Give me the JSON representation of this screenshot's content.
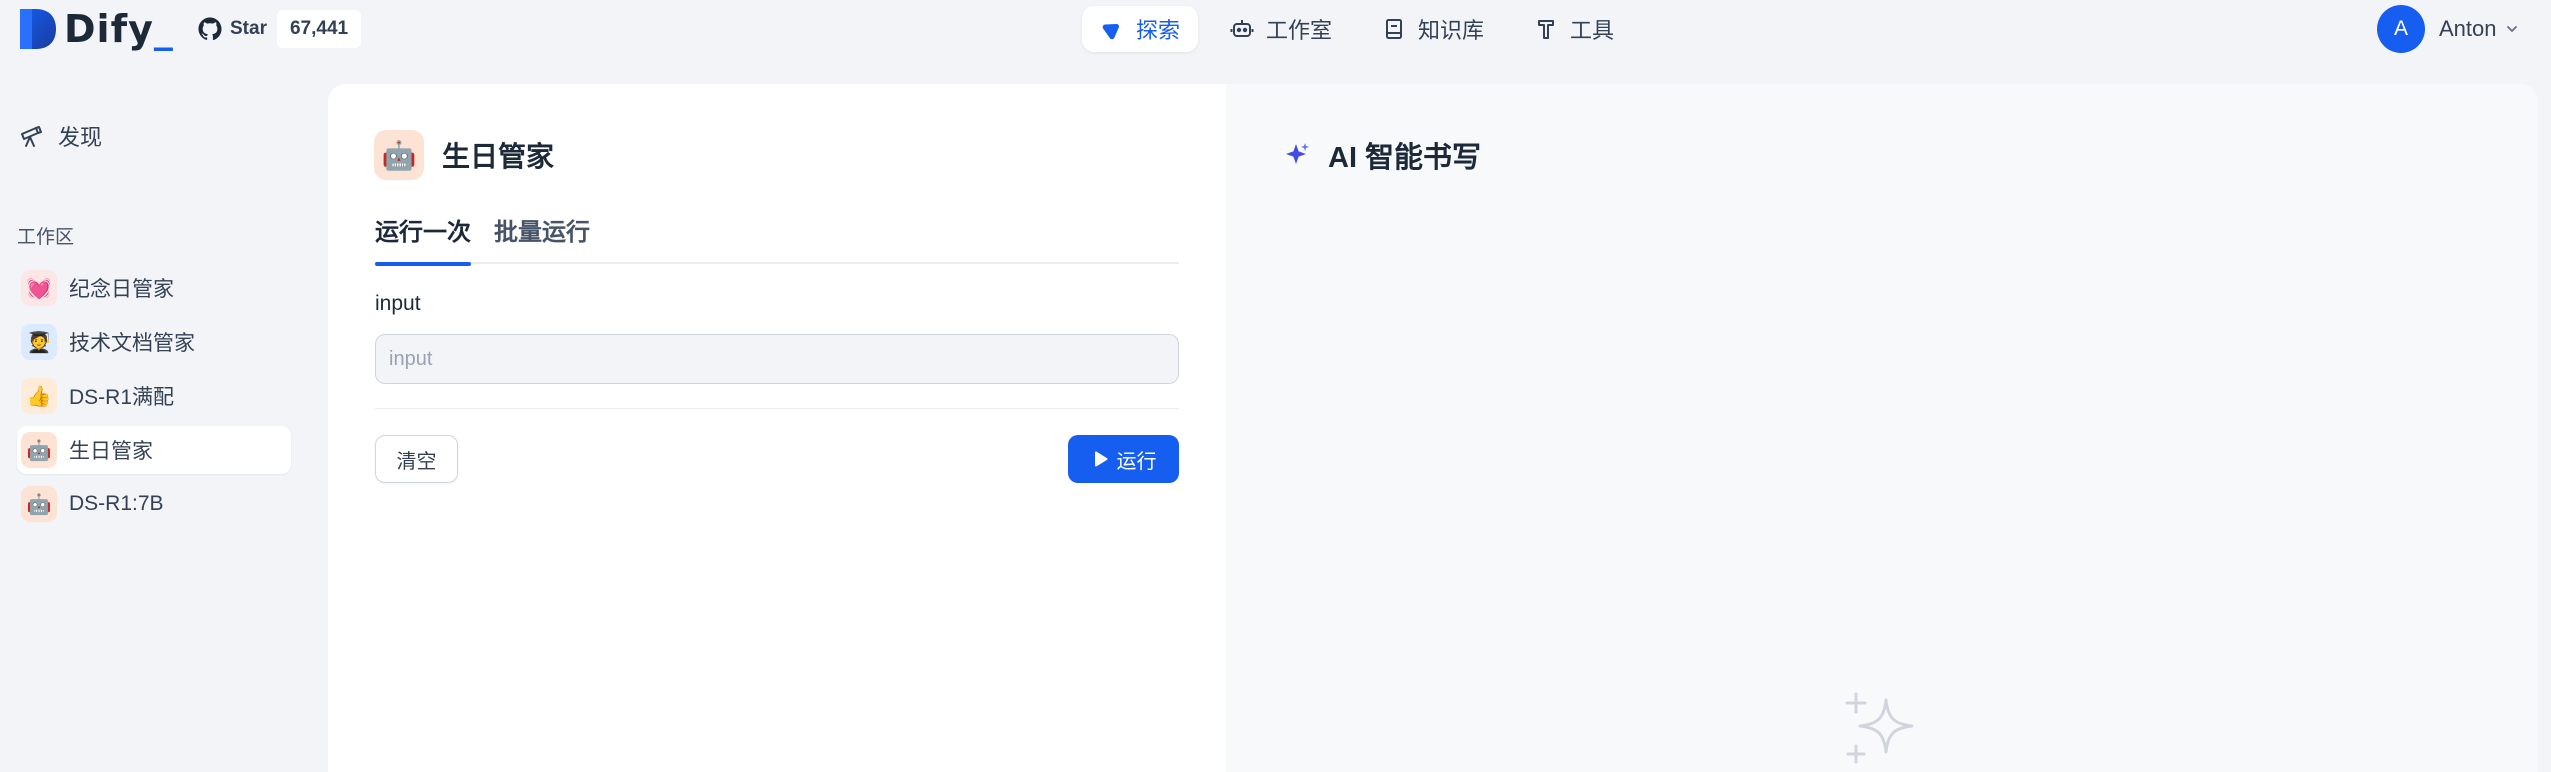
{
  "brand": {
    "name": "Dify",
    "underscore": "_",
    "accent": "#155eef"
  },
  "github": {
    "star_label": "Star",
    "star_count": "67,441"
  },
  "nav": {
    "items": [
      {
        "label": "探索",
        "icon": "compass-icon",
        "active": true
      },
      {
        "label": "工作室",
        "icon": "robot-icon",
        "active": false
      },
      {
        "label": "知识库",
        "icon": "book-icon",
        "active": false
      },
      {
        "label": "工具",
        "icon": "hammer-icon",
        "active": false
      }
    ]
  },
  "user": {
    "initial": "A",
    "name": "Anton"
  },
  "sidebar": {
    "discover_label": "发现",
    "section_label": "工作区",
    "apps": [
      {
        "label": "纪念日管家",
        "emoji": "💓",
        "bg": "#fde6e6"
      },
      {
        "label": "技术文档管家",
        "emoji": "🧑‍🎓",
        "bg": "#dbeafe"
      },
      {
        "label": "DS-R1满配",
        "emoji": "👍",
        "bg": "#feecd9"
      },
      {
        "label": "生日管家",
        "emoji": "🤖",
        "bg": "#fde3d3",
        "active": true
      },
      {
        "label": "DS-R1:7B",
        "emoji": "🤖",
        "bg": "#fde3d3"
      }
    ]
  },
  "app": {
    "title": "生日管家",
    "icon_emoji": "🤖",
    "tabs": {
      "run_once": "运行一次",
      "batch_run": "批量运行"
    },
    "field_label": "input",
    "field_placeholder": "input",
    "clear_label": "清空",
    "run_label": "运行"
  },
  "ai_panel": {
    "title": "AI 智能书写"
  }
}
